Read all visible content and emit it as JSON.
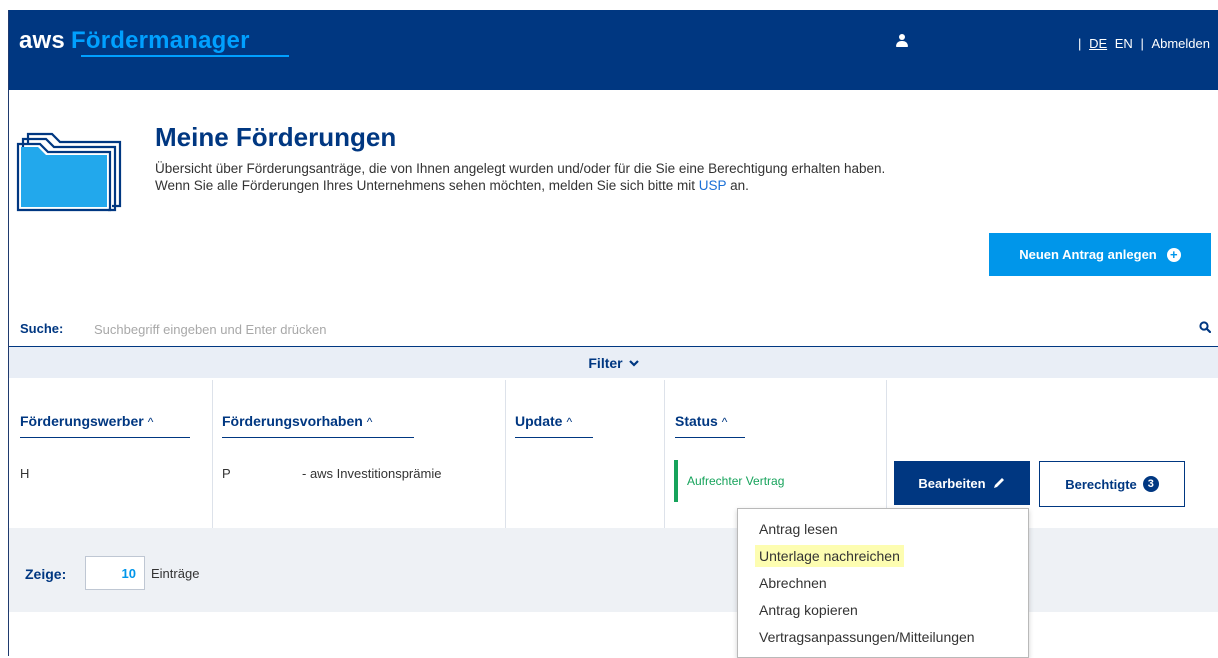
{
  "header": {
    "brand_aws": "aws",
    "brand_name": "Fördermanager",
    "lang_de": "DE",
    "lang_en": "EN",
    "separator": "|",
    "logout": "Abmelden"
  },
  "intro": {
    "title": "Meine Förderungen",
    "description_before": "Übersicht über Förderungsanträge, die von Ihnen angelegt wurden und/oder für die Sie eine Berechtigung erhalten haben. Wenn Sie alle Förderungen Ihres Unternehmens sehen möchten, melden Sie sich bitte mit ",
    "description_link": "USP",
    "description_after": " an.",
    "new_request_button": "Neuen Antrag anlegen"
  },
  "search": {
    "label": "Suche:",
    "placeholder": "Suchbegriff eingeben und Enter drücken"
  },
  "filter": {
    "label": "Filter"
  },
  "table": {
    "columns": [
      "Förderungswerber",
      "Förderungsvorhaben",
      "Update",
      "Status"
    ],
    "sort_arrow": "^",
    "rows": [
      {
        "applicant": "H",
        "project_code": "P",
        "project_name": "- aws Investitionsprämie",
        "update": "",
        "status": "Aufrechter Vertrag",
        "edit_button": "Bearbeiten",
        "authorized_button": "Berechtigte",
        "authorized_count": "3"
      }
    ]
  },
  "pagination": {
    "show_label": "Zeige:",
    "page_size": "10",
    "entries_label": "Einträge"
  },
  "dropdown": {
    "items": [
      "Antrag lesen",
      "Unterlage nachreichen",
      "Abrechnen",
      "Antrag kopieren",
      "Vertragsanpassungen/Mitteilungen"
    ],
    "highlighted_index": 1
  },
  "colors": {
    "primary": "#003781",
    "accent": "#0096ea",
    "status_green": "#16a35b",
    "highlight": "#fdfdb1"
  }
}
